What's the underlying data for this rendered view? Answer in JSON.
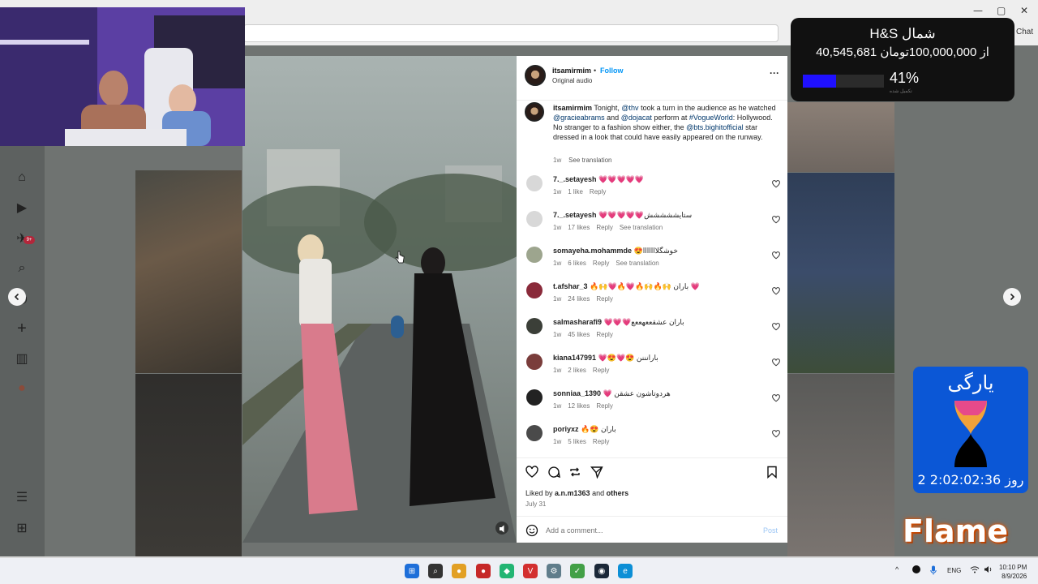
{
  "browser": {
    "chat_label": "Chat",
    "controls": {
      "minimize": "—",
      "maximize": "▢",
      "close": "✕"
    }
  },
  "sidebar": {
    "items": [
      {
        "name": "home-icon",
        "glyph": "⌂"
      },
      {
        "name": "reels-icon",
        "glyph": "▶"
      },
      {
        "name": "messages-icon",
        "glyph": "✈"
      },
      {
        "name": "search-icon",
        "glyph": "⌕"
      },
      {
        "name": "explore-icon",
        "glyph": "◎"
      },
      {
        "name": "create-icon",
        "glyph": "+"
      },
      {
        "name": "dashboard-icon",
        "glyph": "▥"
      },
      {
        "name": "profile-icon",
        "glyph": "●"
      },
      {
        "name": "menu-icon",
        "glyph": "☰"
      },
      {
        "name": "more-apps-icon",
        "glyph": "⊞"
      }
    ],
    "messages_badge": "9+"
  },
  "post": {
    "username": "itsamirmim",
    "separator": "•",
    "follow_label": "Follow",
    "audio": "Original audio",
    "more": "···",
    "caption": {
      "user": "itsamirmim",
      "parts": [
        {
          "t": " Tonight, ",
          "tag": false
        },
        {
          "t": "@thv",
          "tag": true
        },
        {
          "t": " took a turn in the audience as he watched ",
          "tag": false
        },
        {
          "t": "@gracieabrams",
          "tag": true
        },
        {
          "t": " and ",
          "tag": false
        },
        {
          "t": "@dojacat",
          "tag": true
        },
        {
          "t": " perform at ",
          "tag": false
        },
        {
          "t": "#VogueWorld",
          "tag": true
        },
        {
          "t": ": Hollywood. No stranger to a fashion show either, the ",
          "tag": false
        },
        {
          "t": "@bts.bighitofficial",
          "tag": true
        },
        {
          "t": " star dressed in a look that could have easily appeared on the runway.",
          "tag": false
        }
      ],
      "age": "1w",
      "see_translation": "See translation"
    },
    "comments": [
      {
        "user": "7._.setayesh",
        "text": "💗💗💗💗💗",
        "age": "1w",
        "likes": "1 like",
        "reply": "Reply",
        "translate": "",
        "avatar": "#d8d8d8"
      },
      {
        "user": "7._.setayesh",
        "text": "💗💗💗💗💗ستایششششش",
        "age": "1w",
        "likes": "17 likes",
        "reply": "Reply",
        "translate": "See translation",
        "avatar": "#d8d8d8"
      },
      {
        "user": "somayeha.mohammde",
        "text": "😍خوشگلااااااا",
        "age": "1w",
        "likes": "6 likes",
        "reply": "Reply",
        "translate": "See translation",
        "avatar": "#9da58e"
      },
      {
        "user": "t.afshar_3",
        "text": "🔥🙌💗🔥💗🔥🙌🔥🙌 باران 💗",
        "age": "1w",
        "likes": "24 likes",
        "reply": "Reply",
        "translate": "",
        "avatar": "#8a2a3a"
      },
      {
        "user": "salmasharafi9",
        "text": "💗💗💗باران عشقععهععع",
        "age": "1w",
        "likes": "45 likes",
        "reply": "Reply",
        "translate": "",
        "avatar": "#3b3f38"
      },
      {
        "user": "kiana147991",
        "text": "💗😍💗😍 بارانننن",
        "age": "1w",
        "likes": "2 likes",
        "reply": "Reply",
        "translate": "",
        "avatar": "#7a3d3b"
      },
      {
        "user": "sonniaa_1390",
        "text": "💗 هردوتاشون عشقن",
        "age": "1w",
        "likes": "12 likes",
        "reply": "Reply",
        "translate": "",
        "avatar": "#222222"
      },
      {
        "user": "poriyxz",
        "text": "🔥😍 باران",
        "age": "1w",
        "likes": "5 likes",
        "reply": "Reply",
        "translate": "",
        "avatar": "#4a4a4a"
      }
    ],
    "liked_by_prefix": "Liked by ",
    "liked_by_user": "a.n.m1363",
    "liked_by_suffix": " and ",
    "liked_by_others": "others",
    "date": "July 31",
    "add_comment_placeholder": "Add a comment...",
    "post_label": "Post"
  },
  "donation": {
    "title": "H&S شمال",
    "amount": "40,545,681 از 100,000,000تومان",
    "percent": "41%",
    "progress": 0.41,
    "subtext": "تکمیل شده"
  },
  "timer": {
    "title": "یارگی",
    "countdown": "2 روز 2:02:02:36"
  },
  "flame_text": "Flame",
  "taskbar": {
    "apps": [
      {
        "name": "start-icon",
        "glyph": "⊞",
        "color": "#1e6fd9"
      },
      {
        "name": "search-icon",
        "glyph": "⌕",
        "color": "#333333"
      },
      {
        "name": "chrome-icon",
        "glyph": "●",
        "color": "#e2a024"
      },
      {
        "name": "app-red-icon",
        "glyph": "●",
        "color": "#c62828"
      },
      {
        "name": "app-green-icon",
        "glyph": "◆",
        "color": "#22b573"
      },
      {
        "name": "vivaldi-icon",
        "glyph": "V",
        "color": "#d32f2f"
      },
      {
        "name": "settings-icon",
        "glyph": "⚙",
        "color": "#607d8b"
      },
      {
        "name": "app-check-icon",
        "glyph": "✓",
        "color": "#43a047"
      },
      {
        "name": "steam-icon",
        "glyph": "◉",
        "color": "#1b2838"
      },
      {
        "name": "edge-icon",
        "glyph": "e",
        "color": "#0c8fd6"
      }
    ],
    "tray_chevron": "^",
    "language": "ENG",
    "time": "10:10 PM",
    "date": "8/9/2026"
  }
}
